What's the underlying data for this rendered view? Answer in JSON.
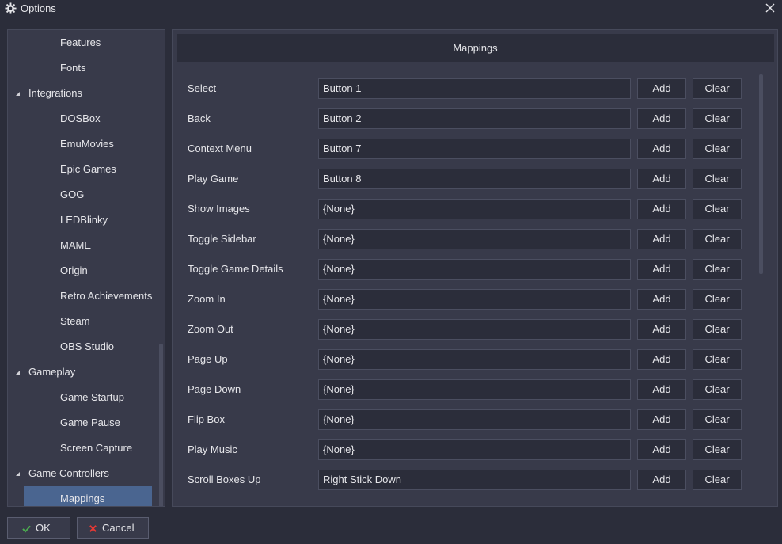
{
  "window": {
    "title": "Options",
    "title_icon": "gear-icon",
    "close_icon": "close-icon"
  },
  "sidebar": {
    "items": [
      {
        "label": "Features",
        "level": 2,
        "expanded": null,
        "selected": false
      },
      {
        "label": "Fonts",
        "level": 2,
        "expanded": null,
        "selected": false
      },
      {
        "label": "Integrations",
        "level": 1,
        "expanded": true,
        "selected": false
      },
      {
        "label": "DOSBox",
        "level": 2,
        "expanded": null,
        "selected": false
      },
      {
        "label": "EmuMovies",
        "level": 2,
        "expanded": null,
        "selected": false
      },
      {
        "label": "Epic Games",
        "level": 2,
        "expanded": null,
        "selected": false
      },
      {
        "label": "GOG",
        "level": 2,
        "expanded": null,
        "selected": false
      },
      {
        "label": "LEDBlinky",
        "level": 2,
        "expanded": null,
        "selected": false
      },
      {
        "label": "MAME",
        "level": 2,
        "expanded": null,
        "selected": false
      },
      {
        "label": "Origin",
        "level": 2,
        "expanded": null,
        "selected": false
      },
      {
        "label": "Retro Achievements",
        "level": 2,
        "expanded": null,
        "selected": false
      },
      {
        "label": "Steam",
        "level": 2,
        "expanded": null,
        "selected": false
      },
      {
        "label": "OBS Studio",
        "level": 2,
        "expanded": null,
        "selected": false
      },
      {
        "label": "Gameplay",
        "level": 1,
        "expanded": true,
        "selected": false
      },
      {
        "label": "Game Startup",
        "level": 2,
        "expanded": null,
        "selected": false
      },
      {
        "label": "Game Pause",
        "level": 2,
        "expanded": null,
        "selected": false
      },
      {
        "label": "Screen Capture",
        "level": 2,
        "expanded": null,
        "selected": false
      },
      {
        "label": "Game Controllers",
        "level": 1,
        "expanded": true,
        "selected": false
      },
      {
        "label": "Mappings",
        "level": 2,
        "expanded": null,
        "selected": true
      }
    ]
  },
  "main": {
    "header": "Mappings",
    "add_label": "Add",
    "clear_label": "Clear",
    "mappings": [
      {
        "action": "Select",
        "value": "Button 1"
      },
      {
        "action": "Back",
        "value": "Button 2"
      },
      {
        "action": "Context Menu",
        "value": "Button 7"
      },
      {
        "action": "Play Game",
        "value": "Button 8"
      },
      {
        "action": "Show Images",
        "value": "{None}"
      },
      {
        "action": "Toggle Sidebar",
        "value": "{None}"
      },
      {
        "action": "Toggle Game Details",
        "value": "{None}"
      },
      {
        "action": "Zoom In",
        "value": "{None}"
      },
      {
        "action": "Zoom Out",
        "value": "{None}"
      },
      {
        "action": "Page Up",
        "value": "{None}"
      },
      {
        "action": "Page Down",
        "value": "{None}"
      },
      {
        "action": "Flip Box",
        "value": "{None}"
      },
      {
        "action": "Play Music",
        "value": "{None}"
      },
      {
        "action": "Scroll Boxes Up",
        "value": "Right Stick Down"
      }
    ]
  },
  "footer": {
    "ok_label": "OK",
    "ok_icon": "check-icon",
    "cancel_label": "Cancel",
    "cancel_icon": "cancel-x-icon"
  },
  "colors": {
    "background": "#2b2d3a",
    "panel": "#383a4a",
    "selected": "#4a6590",
    "check": "#4caf50",
    "cancel": "#e53935",
    "text": "#e6e6ea"
  }
}
